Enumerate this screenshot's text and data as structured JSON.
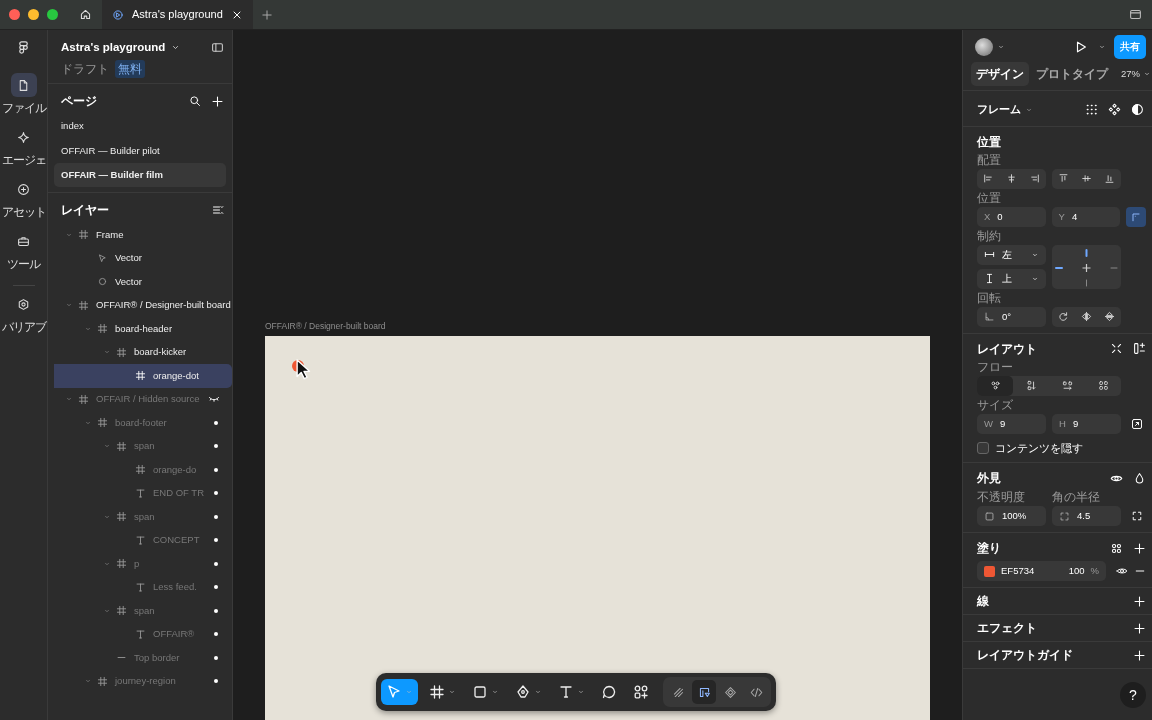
{
  "titlebar": {
    "tabs": [
      {
        "kind": "home",
        "selected": false
      },
      {
        "kind": "file",
        "label": "Astra's playground",
        "selected": true
      }
    ]
  },
  "rail": [
    {
      "kind": "file",
      "label": "ファイル",
      "selected": true
    },
    {
      "kind": "agent",
      "label": "エージェ",
      "selected": false
    },
    {
      "kind": "assets",
      "label": "アセット",
      "selected": false
    },
    {
      "kind": "tools",
      "label": "ツール",
      "selected": false
    },
    {
      "kind": "variables",
      "label": "バリアブ",
      "selected": false
    }
  ],
  "file": {
    "name": "Astra's playground",
    "location": "ドラフト",
    "plan": "無料"
  },
  "pages": {
    "title": "ページ",
    "items": [
      {
        "label": "index",
        "selected": false
      },
      {
        "label": "OFFAIR — Builder pilot",
        "selected": false
      },
      {
        "label": "OFFAIR — Builder film",
        "selected": true
      }
    ]
  },
  "layers": {
    "title": "レイヤー",
    "items": [
      {
        "name": "Frame",
        "kind": "frame",
        "expanded": true,
        "selected": false,
        "hidden": false,
        "children": [
          {
            "name": "Vector",
            "kind": "vector",
            "selected": false,
            "hidden": false
          },
          {
            "name": "Vector",
            "kind": "ellipse",
            "selected": false,
            "hidden": false
          }
        ]
      },
      {
        "name": "OFFAIR® / Designer-built board",
        "kind": "frame",
        "expanded": true,
        "selected": false,
        "hidden": false,
        "children": [
          {
            "name": "board-header",
            "kind": "frame",
            "expanded": true,
            "selected": false,
            "hidden": false,
            "children": [
              {
                "name": "board-kicker",
                "kind": "frame",
                "expanded": true,
                "selected": false,
                "hidden": false,
                "children": [
                  {
                    "name": "orange-dot",
                    "kind": "frame",
                    "selected": true,
                    "hidden": false
                  }
                ]
              }
            ]
          }
        ]
      },
      {
        "name": "OFFAIR / Hidden source",
        "kind": "frame",
        "expanded": true,
        "selected": false,
        "hidden": true,
        "children": [
          {
            "name": "board-footer",
            "kind": "frame",
            "expanded": true,
            "selected": false,
            "hidden": true,
            "children": [
              {
                "name": "span",
                "kind": "frame",
                "expanded": true,
                "selected": false,
                "hidden": true,
                "children": [
                  {
                    "name": "orange-do",
                    "kind": "frame",
                    "selected": false,
                    "hidden": true
                  },
                  {
                    "name": "END OF TR",
                    "kind": "text",
                    "selected": false,
                    "hidden": true
                  }
                ]
              },
              {
                "name": "span",
                "kind": "frame",
                "expanded": true,
                "selected": false,
                "hidden": true,
                "children": [
                  {
                    "name": "CONCEPT",
                    "kind": "text",
                    "selected": false,
                    "hidden": true
                  }
                ]
              },
              {
                "name": "p",
                "kind": "frame",
                "expanded": true,
                "selected": false,
                "hidden": true,
                "children": [
                  {
                    "name": "Less feed.",
                    "kind": "text",
                    "selected": false,
                    "hidden": true
                  }
                ]
              },
              {
                "name": "span",
                "kind": "frame",
                "expanded": true,
                "selected": false,
                "hidden": true,
                "children": [
                  {
                    "name": "OFFAIR®",
                    "kind": "text",
                    "selected": false,
                    "hidden": true
                  }
                ]
              },
              {
                "name": "Top border",
                "kind": "line",
                "selected": false,
                "hidden": true
              }
            ]
          },
          {
            "name": "journey-region",
            "kind": "frame",
            "expanded": true,
            "selected": false,
            "hidden": true
          }
        ]
      }
    ]
  },
  "header": {
    "share": "共有"
  },
  "mode_tabs": [
    {
      "label": "デザイン",
      "selected": true
    },
    {
      "label": "プロトタイプ",
      "selected": false
    }
  ],
  "zoom": "27%",
  "frame_menu": "フレーム",
  "position": {
    "title": "位置",
    "align_label": "配置",
    "position_label": "位置",
    "x": {
      "label": "X",
      "value": "0"
    },
    "y": {
      "label": "Y",
      "value": "4"
    },
    "absolute": true,
    "constraints_label": "制約",
    "horizontal": "左",
    "vertical": "上",
    "pins": {
      "left": true,
      "right": false,
      "top": true,
      "bottom": false
    },
    "rotation_label": "回転",
    "rotation": "0°"
  },
  "layout": {
    "title": "レイアウト",
    "flow_label": "フロー",
    "flows": [
      {
        "kind": "free",
        "selected": true
      },
      {
        "kind": "vertical",
        "selected": false
      },
      {
        "kind": "horizontal",
        "selected": false
      },
      {
        "kind": "grid",
        "selected": false
      }
    ],
    "size_label": "サイズ",
    "w": {
      "label": "W",
      "value": "9"
    },
    "h": {
      "label": "H",
      "value": "9"
    },
    "clip_label": "コンテンツを隠す",
    "clip_checked": false
  },
  "appearance": {
    "title": "外見",
    "opacity_label": "不透明度",
    "opacity": "100%",
    "radius_label": "角の半径",
    "radius": "4.5"
  },
  "fill": {
    "title": "塗り",
    "color": "#ef5734",
    "hex": "EF5734",
    "opacity": "100",
    "unit": "%"
  },
  "stroke": {
    "title": "線"
  },
  "effects": {
    "title": "エフェクト"
  },
  "layout_guide": {
    "title": "レイアウトガイド"
  },
  "help": "?",
  "canvas": {
    "frame_label": "OFFAIR® / Designer-built board"
  },
  "toolbar": {
    "tools": [
      {
        "kind": "move",
        "selected": true,
        "menu": true
      },
      {
        "kind": "frame",
        "selected": false,
        "menu": true
      },
      {
        "kind": "rectangle",
        "selected": false,
        "menu": true
      },
      {
        "kind": "pen",
        "selected": false,
        "menu": true
      },
      {
        "kind": "text",
        "selected": false,
        "menu": true
      },
      {
        "kind": "comment",
        "selected": false,
        "menu": false
      },
      {
        "kind": "actions",
        "selected": false,
        "menu": false
      }
    ],
    "modes": [
      {
        "kind": "draw",
        "selected": false
      },
      {
        "kind": "design",
        "selected": true
      },
      {
        "kind": "dev",
        "selected": false
      },
      {
        "kind": "code",
        "selected": false
      }
    ]
  }
}
